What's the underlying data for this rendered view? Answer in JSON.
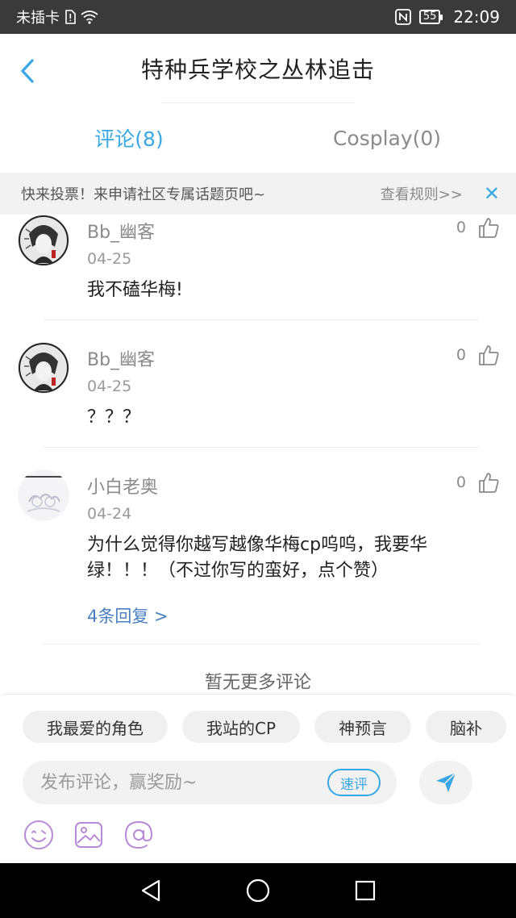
{
  "status_bar": {
    "carrier": "未插卡",
    "battery": "55",
    "time": "22:09"
  },
  "header": {
    "title": "特种兵学校之丛林追击"
  },
  "tabs": [
    {
      "label": "评论(8)",
      "active": true
    },
    {
      "label": "Cosplay(0)",
      "active": false
    }
  ],
  "notice": {
    "text": "快来投票！来申请社区专属话题页吧~",
    "rules_link": "查看规则>>",
    "close_icon": "close-icon"
  },
  "comments": [
    {
      "username": "Bb_幽客",
      "date": "04-25",
      "content": "我不磕华梅!",
      "likes": "0"
    },
    {
      "username": "Bb_幽客",
      "date": "04-25",
      "content": "？？？",
      "likes": "0"
    },
    {
      "username": "小白老奥",
      "date": "04-24",
      "content": "为什么觉得你越写越像华梅cp呜呜，我要华绿！！！（不过你写的蛮好，点个赞）",
      "likes": "0",
      "replies": "4条回复 >"
    }
  ],
  "no_more": "暂无更多评论",
  "compose": {
    "chips": [
      "我最爱的角色",
      "我站的CP",
      "神预言",
      "脑补"
    ],
    "placeholder": "发布评论，赢奖励~",
    "quick_review": "速评"
  },
  "colors": {
    "accent": "#39a7e3",
    "link": "#4a7fc1",
    "icon_purple": "#b98ad6"
  }
}
